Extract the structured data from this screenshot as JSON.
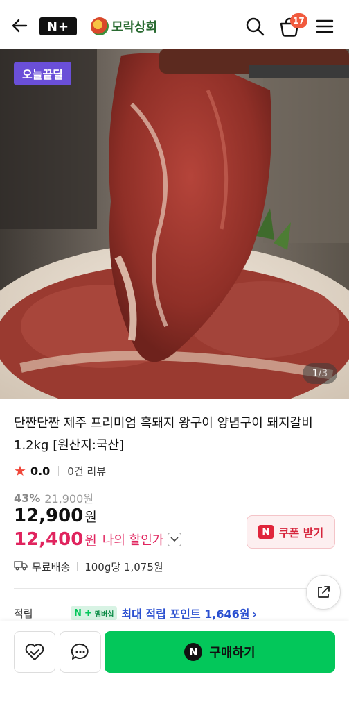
{
  "header": {
    "logo_label": "N+",
    "store_name": "모락상회",
    "cart_count": "17"
  },
  "hero": {
    "deal_badge": "오늘끝딜",
    "counter_current": "1",
    "counter_total": "3"
  },
  "product": {
    "title": "단짠단짠 제주 프리미엄 흑돼지 왕구이 양념구이 돼지갈비 1.2kg [원산지:국산]",
    "rating": "0.0",
    "review_count": "0건 리뷰",
    "discount": "43%",
    "original_price": "21,900원",
    "price": "12,900",
    "price_unit": "원",
    "my_price": "12,400",
    "my_price_unit": "원",
    "my_price_label": "나의 할인가",
    "coupon_label": "쿠폰 받기",
    "coupon_icon_letter": "N",
    "shipping": "무료배송",
    "unit_price": "100g당 1,075원",
    "points_label": "적립",
    "membership_n": "N",
    "membership_plus": "+",
    "membership_badge": "멤버십",
    "points_text": "최대 적립 포인트 1,646원"
  },
  "bottom": {
    "buy_label": "구매하기",
    "buy_icon_letter": "N"
  },
  "colors": {
    "accent_green": "#03c75a",
    "price_red": "#e0245e",
    "deal_purple": "#6a4fd8",
    "points_blue": "#2a4fd0"
  }
}
